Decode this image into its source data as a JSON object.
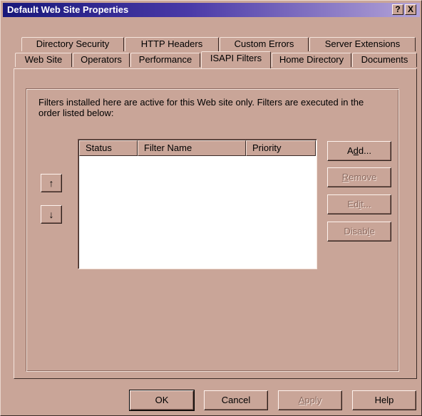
{
  "window": {
    "title": "Default Web Site Properties",
    "help_label": "?",
    "close_label": "X"
  },
  "tabs": {
    "row1": [
      "Directory Security",
      "HTTP Headers",
      "Custom Errors",
      "Server Extensions"
    ],
    "row2": [
      "Web Site",
      "Operators",
      "Performance",
      "ISAPI Filters",
      "Home Directory",
      "Documents"
    ],
    "active": "ISAPI Filters"
  },
  "panel": {
    "description": "Filters installed here are active for this Web site only. Filters are executed in the order listed below:",
    "columns": [
      "Status",
      "Filter Name",
      "Priority"
    ],
    "rows": [],
    "move_up_icon": "↑",
    "move_down_icon": "↓"
  },
  "side_buttons": {
    "add": {
      "pre": "A",
      "key": "d",
      "post": "d..."
    },
    "remove": {
      "pre": "",
      "key": "R",
      "post": "emove"
    },
    "edit": {
      "pre": "Ed",
      "key": "i",
      "post": "t..."
    },
    "disable": {
      "pre": "Disab",
      "key": "l",
      "post": "e"
    }
  },
  "footer": {
    "ok": "OK",
    "cancel": "Cancel",
    "apply_key": "A",
    "apply_rest": "pply",
    "help": "Help"
  },
  "colors": {
    "face": "#c9a598",
    "title_start": "#18187a",
    "title_end": "#b4a4d8"
  }
}
